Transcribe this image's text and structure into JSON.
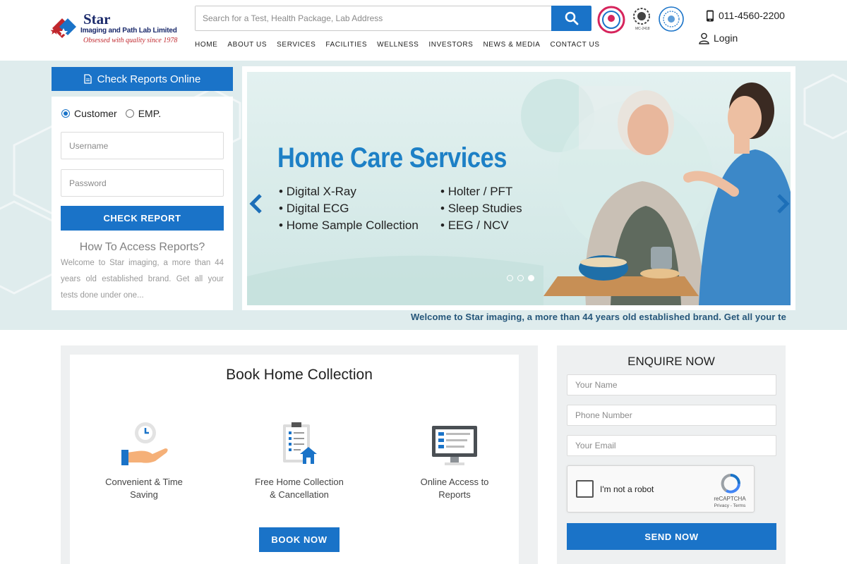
{
  "brand": {
    "name": "Star",
    "subtitle": "Imaging and Path Lab Limited",
    "tagline": "Obsessed with quality since 1978"
  },
  "search": {
    "placeholder": "Search for a Test, Health Package, Lab Address",
    "value": ""
  },
  "badges": [
    "NABH",
    "MC-2418",
    "seal"
  ],
  "contact": {
    "phone": "011-4560-2200",
    "login_label": "Login"
  },
  "nav": {
    "items": [
      "HOME",
      "ABOUT US",
      "SERVICES",
      "FACILITIES",
      "WELLNESS",
      "INVESTORS",
      "NEWS & MEDIA",
      "CONTACT US"
    ]
  },
  "reports": {
    "header": "Check Reports Online",
    "radio_options": [
      {
        "label": "Customer",
        "selected": true
      },
      {
        "label": "EMP.",
        "selected": false
      }
    ],
    "username_placeholder": "Username",
    "password_placeholder": "Password",
    "button_label": "CHECK REPORT",
    "how_title": "How To Access Reports?",
    "how_text": "Welcome to Star imaging, a more than 44 years old established brand. Get all your tests done under one..."
  },
  "slider": {
    "title": "Home Care Services",
    "list_left": [
      "Digital X-Ray",
      "Digital ECG",
      "Home Sample Collection"
    ],
    "list_right": [
      "Holter / PFT",
      "Sleep Studies",
      "EEG / NCV"
    ],
    "dot_count": 3,
    "active_dot": 2
  },
  "marquee": {
    "text": "Welcome to Star imaging, a more than 44 years old established brand. Get all your te"
  },
  "book": {
    "title": "Book Home Collection",
    "features": [
      {
        "icon": "clock-hand-icon",
        "label_1": "Convenient & Time",
        "label_2": "Saving"
      },
      {
        "icon": "clipboard-home-icon",
        "label_1": "Free Home Collection",
        "label_2": "& Cancellation"
      },
      {
        "icon": "monitor-report-icon",
        "label_1": "Online Access to",
        "label_2": "Reports"
      }
    ],
    "button_label": "BOOK NOW"
  },
  "enquire": {
    "title": "ENQUIRE NOW",
    "name_placeholder": "Your Name",
    "phone_placeholder": "Phone Number",
    "email_placeholder": "Your Email",
    "captcha_label": "I'm not a robot",
    "captcha_brand": "reCAPTCHA",
    "captcha_links": "Privacy - Terms",
    "button_label": "SEND NOW"
  },
  "colors": {
    "primary": "#1a73c8",
    "brand_navy": "#1b2a6b",
    "brand_red": "#c0272d",
    "hero_bg": "#dfeced"
  }
}
